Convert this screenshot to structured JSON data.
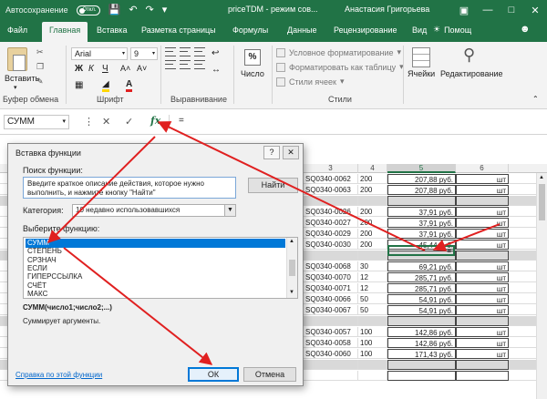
{
  "titlebar": {
    "autosave_label": "Автосохранение",
    "autosave_state": "Откл.",
    "doc_title": "priceTDM - режим сов...",
    "user_name": "Анастасия Григорьева"
  },
  "tabs": [
    "Файл",
    "Главная",
    "Вставка",
    "Разметка страницы",
    "Формулы",
    "Данные",
    "Рецензирование",
    "Вид"
  ],
  "active_tab": "Главная",
  "tell_me": "Помощ",
  "ribbon": {
    "paste_label": "Вставить",
    "clipboard_group": "Буфер обмена",
    "font_group": "Шрифт",
    "font_name": "Arial",
    "font_size": "9",
    "bold": "Ж",
    "italic": "К",
    "underline": "Ч",
    "alignment_group": "Выравнивание",
    "number_label": "Число",
    "number_icon": "%",
    "styles_group": "Стили",
    "styles": [
      "Условное форматирование",
      "Форматировать как таблицу",
      "Стили ячеек"
    ],
    "cells_label": "Ячейки",
    "editing_label": "Редактирование"
  },
  "formula_bar": {
    "name_box": "СУММ",
    "fx": "fx",
    "formula": "="
  },
  "grid": {
    "col_headers": [
      {
        "label": "3"
      },
      {
        "label": "4"
      },
      {
        "label": "5",
        "selected": true
      },
      {
        "label": "6"
      }
    ],
    "rows": [
      {
        "code": "SQ0340-0062",
        "qty": "200",
        "price": "207,88 руб.",
        "unit": "шт"
      },
      {
        "code": "SQ0340-0063",
        "qty": "200",
        "price": "207,88 руб.",
        "unit": "шт"
      },
      {
        "code": "",
        "qty": "",
        "price": "",
        "unit": "",
        "hl": true
      },
      {
        "code": "SQ0340-0026",
        "qty": "200",
        "price": "37,91 руб.",
        "unit": "шт"
      },
      {
        "code": "SQ0340-0027",
        "qty": "200",
        "price": "37,91 руб.",
        "unit": "шт"
      },
      {
        "code": "SQ0340-0029",
        "qty": "200",
        "price": "37,91 руб.",
        "unit": "шт"
      },
      {
        "code": "SQ0340-0030",
        "qty": "200",
        "price": "45,44 руб.",
        "unit": "шт"
      },
      {
        "code": "",
        "qty": "",
        "price": "",
        "unit": "",
        "hl": true
      },
      {
        "code": "SQ0340-0068",
        "qty": "30",
        "price": "69,21 руб.",
        "unit": "шт"
      },
      {
        "code": "SQ0340-0070",
        "qty": "12",
        "price": "285,71 руб.",
        "unit": "шт"
      },
      {
        "code": "SQ0340-0071",
        "qty": "12",
        "price": "285,71 руб.",
        "unit": "шт"
      },
      {
        "code": "SQ0340-0066",
        "qty": "50",
        "price": "54,91 руб.",
        "unit": "шт"
      },
      {
        "code": "SQ0340-0067",
        "qty": "50",
        "price": "54,91 руб.",
        "unit": "шт"
      },
      {
        "code": "",
        "qty": "",
        "price": "",
        "unit": "",
        "hl": true
      },
      {
        "code": "SQ0340-0057",
        "qty": "100",
        "price": "142,86 руб.",
        "unit": "шт"
      },
      {
        "code": "SQ0340-0058",
        "qty": "100",
        "price": "142,86 руб.",
        "unit": "шт"
      },
      {
        "code": "SQ0340-0060",
        "qty": "100",
        "price": "171,43 руб.",
        "unit": "шт"
      },
      {
        "code": "",
        "qty": "",
        "price": "",
        "unit": "",
        "hl": true
      },
      {
        "code": "",
        "qty": "",
        "price": "",
        "unit": ""
      }
    ],
    "active_cell_value": "="
  },
  "dialog": {
    "title": "Вставка функции",
    "help_btn": "?",
    "close_btn": "✕",
    "search_label": "Поиск функции:",
    "search_text": "Введите краткое описание действия, которое нужно выполнить, и нажмите кнопку \"Найти\"",
    "find_button": "Найти",
    "category_label": "Категория:",
    "category_value": "10 недавно использовавшихся",
    "select_label": "Выберите функцию:",
    "functions": [
      "СУММ",
      "СТЕПЕНЬ",
      "СРЗНАЧ",
      "ЕСЛИ",
      "ГИПЕРССЫЛКА",
      "СЧЁТ",
      "МАКС"
    ],
    "selected_function": "СУММ",
    "signature": "СУММ(число1;число2;...)",
    "description": "Суммирует аргументы.",
    "help_link": "Справка по этой функции",
    "ok_button": "ОК",
    "cancel_button": "Отмена"
  },
  "colors": {
    "excel_green": "#217346",
    "annotation_red": "#e02020",
    "selection_blue": "#0078d7"
  }
}
